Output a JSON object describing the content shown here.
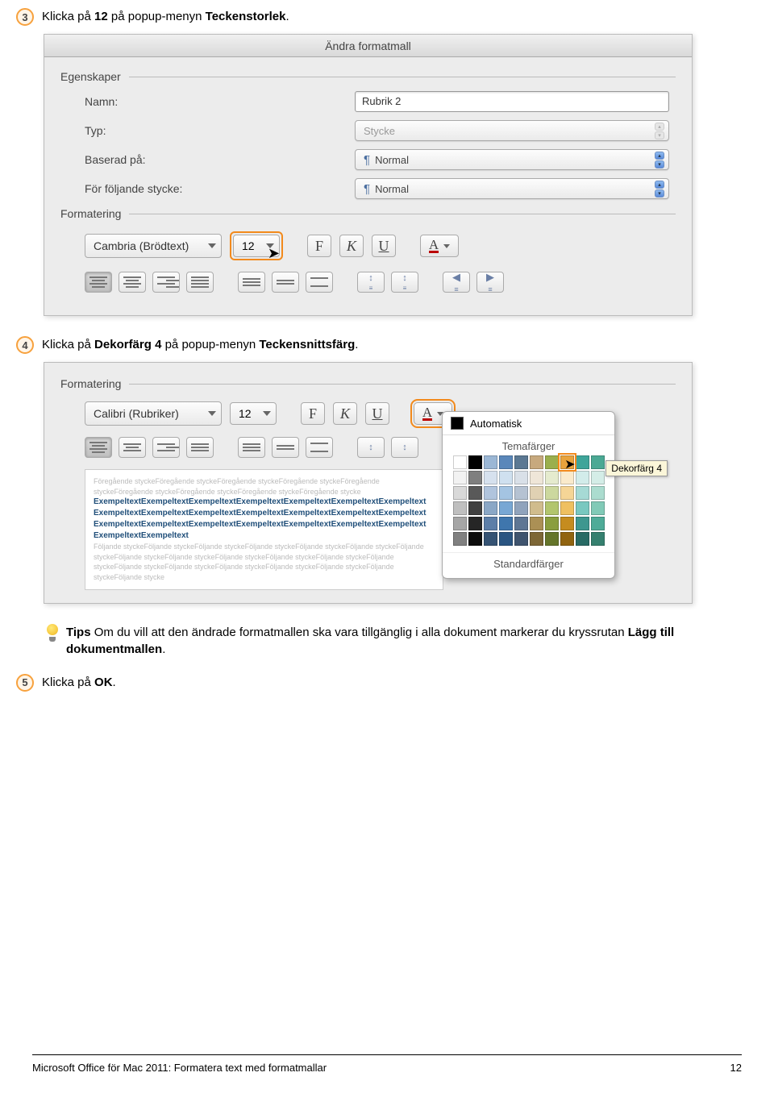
{
  "step3": {
    "num": "3",
    "pre": "Klicka på ",
    "b1": "12",
    "mid": " på popup-menyn ",
    "b2": "Teckenstorlek",
    "post": "."
  },
  "step4": {
    "num": "4",
    "pre": "Klicka på ",
    "b1": "Dekorfärg 4",
    "mid": " på popup-menyn ",
    "b2": "Teckensnittsfärg",
    "post": "."
  },
  "step5": {
    "num": "5",
    "pre": "Klicka på ",
    "b1": "OK",
    "post": "."
  },
  "tip": {
    "lead": "Tips",
    "body": "  Om du vill att den ändrade formatmallen ska vara tillgänglig i alla dokument markerar du kryssrutan ",
    "b": "Lägg till dokumentmallen",
    "tail": "."
  },
  "dlg1": {
    "title": "Ändra formatmall",
    "legend_props": "Egenskaper",
    "label_name": "Namn:",
    "val_name": "Rubrik 2",
    "label_type": "Typ:",
    "val_type": "Stycke",
    "label_based": "Baserad på:",
    "val_based": "Normal",
    "label_follow": "För följande stycke:",
    "val_follow": "Normal",
    "legend_fmt": "Formatering",
    "font": "Cambria (Brödtext)",
    "size": "12",
    "btn_bold": "F",
    "btn_italic": "K",
    "btn_under": "U",
    "btn_color": "A"
  },
  "dlg2": {
    "legend_fmt": "Formatering",
    "font": "Calibri (Rubriker)",
    "size": "12",
    "btn_bold": "F",
    "btn_italic": "K",
    "btn_under": "U",
    "btn_color": "A",
    "auto": "Automatisk",
    "theme_hdr": "Temafärger",
    "std_hdr": "Standardfärger",
    "tooltip": "Dekorfärg 4",
    "preview_blue": "ExempeltextExempeltextExempeltextExempeltextExempeltextExempeltextExempeltext"
  },
  "footer": {
    "left": "Microsoft Office för Mac 2011: Formatera text med formatmallar",
    "right": "12"
  },
  "theme_colors_row0": [
    "#ffffff",
    "#000000",
    "#9bb7d5",
    "#5a87ba",
    "#5b7893",
    "#c7a97e",
    "#9aaf4d",
    "#e8a33d",
    "#3ea59a",
    "#4ba994"
  ],
  "theme_shade_rows": [
    [
      "#f2f2f2",
      "#7f7f7f",
      "#d6e1ee",
      "#cfe0ef",
      "#d9e0e8",
      "#efe6d8",
      "#e5ebce",
      "#faeacb",
      "#d2ecea",
      "#d4ede7"
    ],
    [
      "#d9d9d9",
      "#595959",
      "#b0c4dd",
      "#a4c4e2",
      "#b5c2d2",
      "#e0d1b3",
      "#ccd89e",
      "#f5d596",
      "#a6dad5",
      "#abdccf"
    ],
    [
      "#bfbfbf",
      "#404040",
      "#8aa7c6",
      "#78a7d4",
      "#90a3bc",
      "#d0bc8d",
      "#b2c56d",
      "#efc060",
      "#79c8c0",
      "#81cab7"
    ],
    [
      "#a6a6a6",
      "#262626",
      "#5c7ea8",
      "#3f76ad",
      "#5e7694",
      "#ab9055",
      "#8a9e3e",
      "#c58c1f",
      "#3e978f",
      "#4eab98"
    ],
    [
      "#808080",
      "#0d0d0d",
      "#355374",
      "#2a5582",
      "#3f546e",
      "#7d6736",
      "#65752a",
      "#916410",
      "#286b65",
      "#35806f"
    ]
  ]
}
